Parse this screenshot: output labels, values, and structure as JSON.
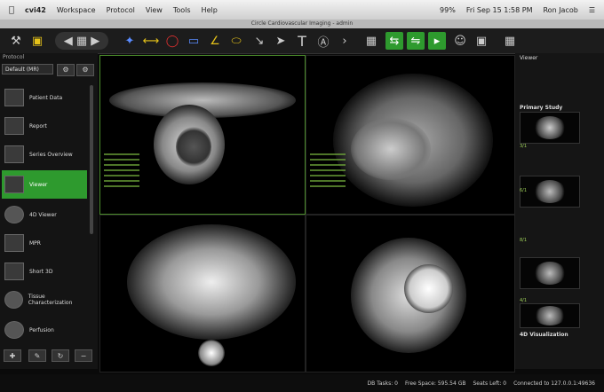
{
  "menubar": {
    "app": "cvi42",
    "items": [
      "Workspace",
      "Protocol",
      "View",
      "Tools",
      "Help"
    ],
    "battery": "99%",
    "datetime": "Fri Sep 15  1:58 PM",
    "user": "Ron Jacob"
  },
  "window_title": "Circle Cardiovascular Imaging - admin",
  "sidebar": {
    "protocol_label": "Protocol",
    "protocol_value": "Default (MR)",
    "items": [
      {
        "label": "Patient Data",
        "icon": "patient-data-icon"
      },
      {
        "label": "Report",
        "icon": "report-icon"
      },
      {
        "label": "Series Overview",
        "icon": "series-overview-icon"
      },
      {
        "label": "Viewer",
        "icon": "viewer-icon"
      },
      {
        "label": "4D Viewer",
        "icon": "4d-viewer-icon"
      },
      {
        "label": "MPR",
        "icon": "mpr-icon"
      },
      {
        "label": "Short 3D",
        "icon": "short-3d-icon"
      },
      {
        "label": "Tissue Characterization",
        "icon": "tissue-icon"
      },
      {
        "label": "Perfusion",
        "icon": "perfusion-icon"
      }
    ]
  },
  "right_panel": {
    "viewer_label": "Viewer",
    "primary_study_label": "Primary Study",
    "thumbs": [
      "3/1",
      "6/1",
      "8/1",
      "4/1"
    ],
    "viz_label": "4D Visualization"
  },
  "statusbar": {
    "db_tasks": "DB Tasks: 0",
    "free_space": "Free Space: 595.54 GB",
    "seats_left": "Seats Left: 0",
    "connection": "Connected to 127.0.0.1:49636"
  }
}
